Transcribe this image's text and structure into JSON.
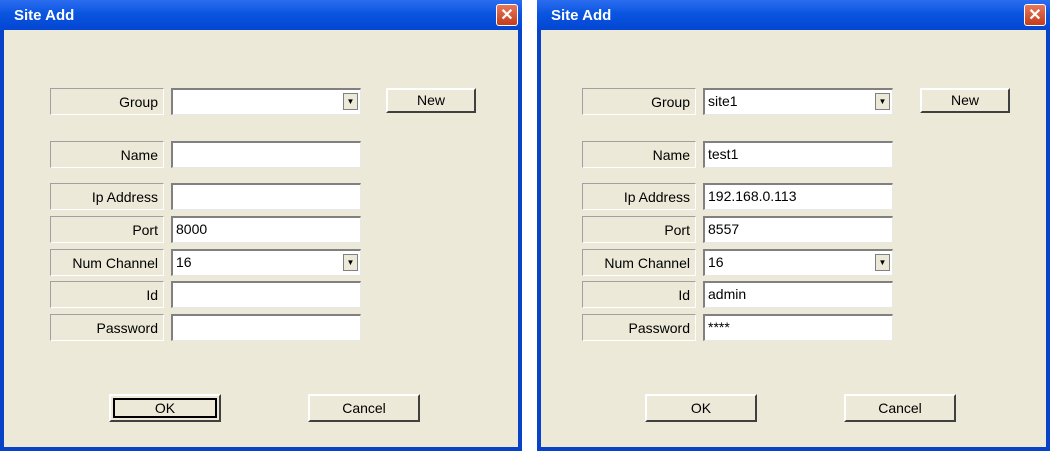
{
  "dialogs": [
    {
      "title": "Site Add",
      "labels": {
        "group": "Group",
        "name": "Name",
        "ip": "Ip Address",
        "port": "Port",
        "channel": "Num Channel",
        "id": "Id",
        "password": "Password"
      },
      "values": {
        "group": "",
        "name": "",
        "ip": "",
        "port": "8000",
        "channel": "16",
        "id": "",
        "password": ""
      },
      "buttons": {
        "new": "New",
        "ok": "OK",
        "cancel": "Cancel"
      }
    },
    {
      "title": "Site Add",
      "labels": {
        "group": "Group",
        "name": "Name",
        "ip": "Ip Address",
        "port": "Port",
        "channel": "Num Channel",
        "id": "Id",
        "password": "Password"
      },
      "values": {
        "group": "site1",
        "name": "test1",
        "ip": "192.168.0.113",
        "port": "8557",
        "channel": "16",
        "id": "admin",
        "password": "****"
      },
      "buttons": {
        "new": "New",
        "ok": "OK",
        "cancel": "Cancel"
      }
    }
  ],
  "icons": {
    "close": "close-icon",
    "dropdown": "dropdown-arrow-icon"
  },
  "colors": {
    "titlebar": "#0a55e0",
    "dialog_bg": "#ece9d8",
    "close": "#d24f2d"
  }
}
